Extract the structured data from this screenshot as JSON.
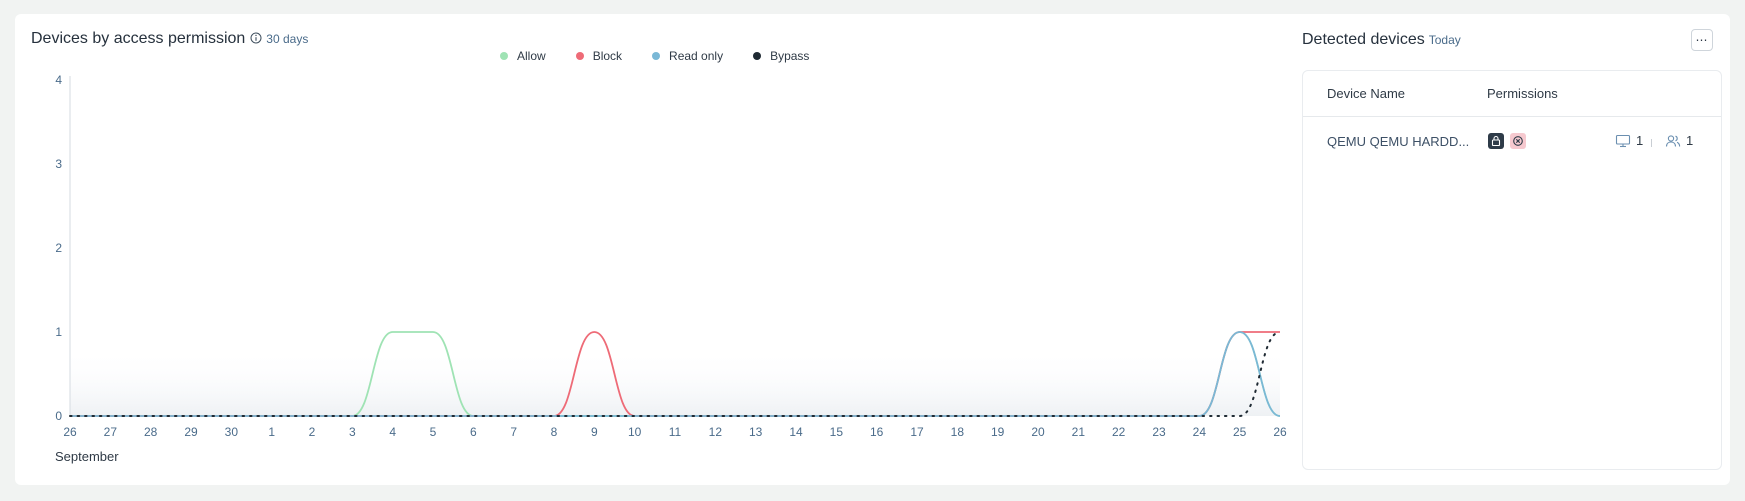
{
  "chart_panel": {
    "title": "Devices by access permission",
    "subtitle": "30 days",
    "icon": "info-icon"
  },
  "legend": [
    {
      "label": "Allow",
      "color": "#9fe3b4"
    },
    {
      "label": "Block",
      "color": "#ee6b77"
    },
    {
      "label": "Read only",
      "color": "#7ab8d6"
    },
    {
      "label": "Bypass",
      "color": "#1f2a33"
    }
  ],
  "chart_data": {
    "type": "line",
    "title": "Devices by access permission",
    "x": [
      "26",
      "27",
      "28",
      "29",
      "30",
      "1",
      "2",
      "3",
      "4",
      "5",
      "6",
      "7",
      "8",
      "9",
      "10",
      "11",
      "12",
      "13",
      "14",
      "15",
      "16",
      "17",
      "18",
      "19",
      "20",
      "21",
      "22",
      "23",
      "24",
      "25",
      "26"
    ],
    "x_month_label": "September",
    "ylim": [
      0,
      4
    ],
    "y_ticks": [
      "0",
      "1",
      "2",
      "3",
      "4"
    ],
    "grid": false,
    "legend_position": "top-center",
    "series": [
      {
        "name": "Allow",
        "color": "#9fe3b4",
        "style": "solid",
        "values": [
          0,
          0,
          0,
          0,
          0,
          0,
          0,
          0,
          1,
          1,
          0,
          0,
          0,
          0,
          0,
          0,
          0,
          0,
          0,
          0,
          0,
          0,
          0,
          0,
          0,
          0,
          0,
          0,
          0,
          1,
          0
        ]
      },
      {
        "name": "Block",
        "color": "#ee6b77",
        "style": "solid",
        "values": [
          0,
          0,
          0,
          0,
          0,
          0,
          0,
          0,
          0,
          0,
          0,
          0,
          0,
          1,
          0,
          0,
          0,
          0,
          0,
          0,
          0,
          0,
          0,
          0,
          0,
          0,
          0,
          0,
          0,
          1,
          1
        ]
      },
      {
        "name": "Read only",
        "color": "#7ab8d6",
        "style": "solid",
        "values": [
          0,
          0,
          0,
          0,
          0,
          0,
          0,
          0,
          0,
          0,
          0,
          0,
          0,
          0,
          0,
          0,
          0,
          0,
          0,
          0,
          0,
          0,
          0,
          0,
          0,
          0,
          0,
          0,
          0,
          1,
          0
        ]
      },
      {
        "name": "Bypass",
        "color": "#1f2a33",
        "style": "dotted",
        "values": [
          0,
          0,
          0,
          0,
          0,
          0,
          0,
          0,
          0,
          0,
          0,
          0,
          0,
          0,
          0,
          0,
          0,
          0,
          0,
          0,
          0,
          0,
          0,
          0,
          0,
          0,
          0,
          0,
          0,
          0,
          1
        ]
      }
    ]
  },
  "devices_panel": {
    "title": "Detected devices",
    "subtitle": "Today",
    "menu_icon": "more-horizontal-icon",
    "columns": [
      "Device Name",
      "Permissions"
    ],
    "rows": [
      {
        "name": "QEMU QEMU HARDD...",
        "permission_icons": [
          "lock-icon",
          "block-icon"
        ],
        "computers": "1",
        "users": "1"
      }
    ]
  }
}
